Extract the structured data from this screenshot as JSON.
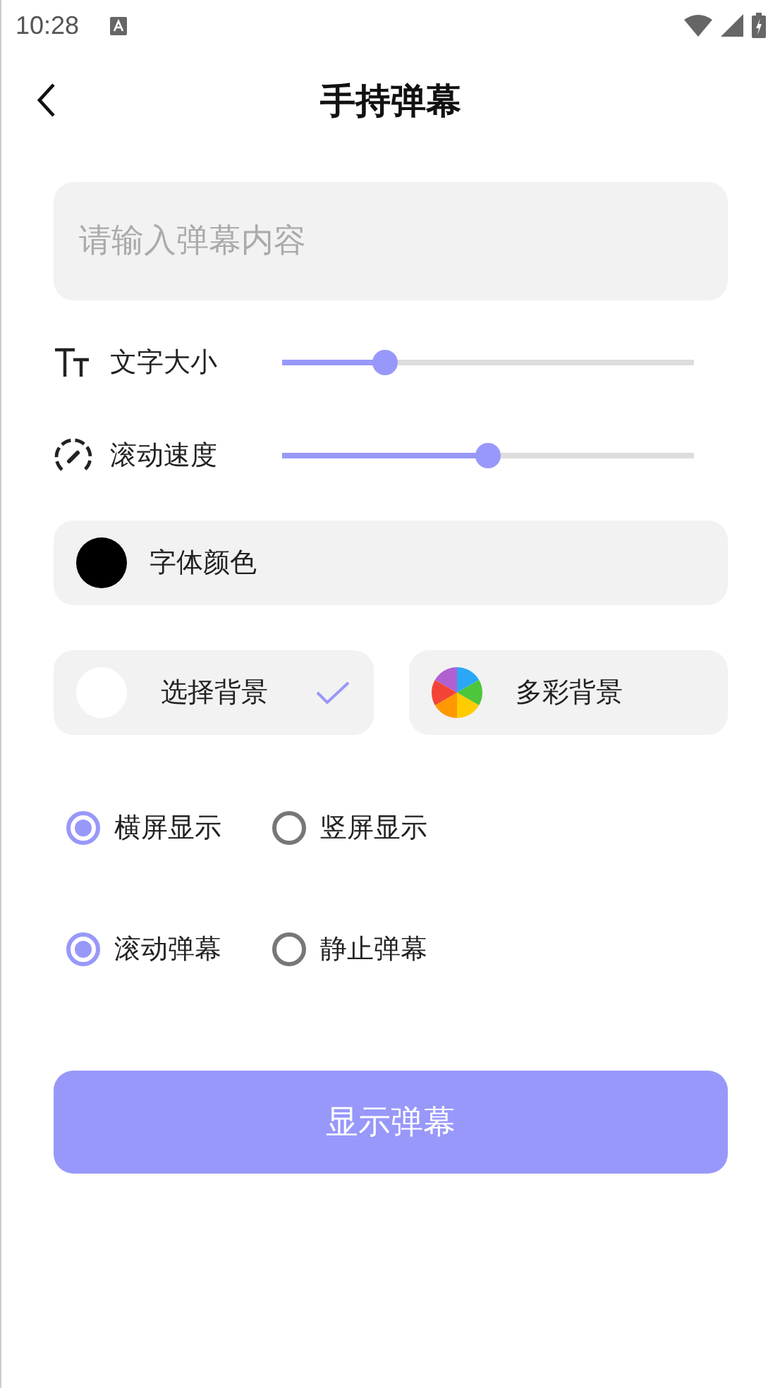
{
  "status_bar": {
    "time": "10:28"
  },
  "header": {
    "title": "手持弹幕"
  },
  "input": {
    "placeholder": "请输入弹幕内容"
  },
  "sliders": [
    {
      "kind": "text-size",
      "label": "文字大小",
      "level": 0.25
    },
    {
      "kind": "speed",
      "label": "滚动速度",
      "level": 0.5
    }
  ],
  "font_color": {
    "label": "字体颜色",
    "color": "#000000"
  },
  "backgrounds": [
    {
      "kind": "plain",
      "label": "选择背景",
      "color": "#ffffff",
      "checked": true
    },
    {
      "kind": "colorful",
      "label": "多彩背景",
      "checked": false
    }
  ],
  "radio_groups": [
    [
      {
        "label": "横屏显示",
        "selected": true
      },
      {
        "label": "竖屏显示",
        "selected": false
      }
    ],
    [
      {
        "label": "滚动弹幕",
        "selected": true
      },
      {
        "label": "静止弹幕",
        "selected": false
      }
    ]
  ],
  "button": {
    "label": "显示弹幕"
  }
}
